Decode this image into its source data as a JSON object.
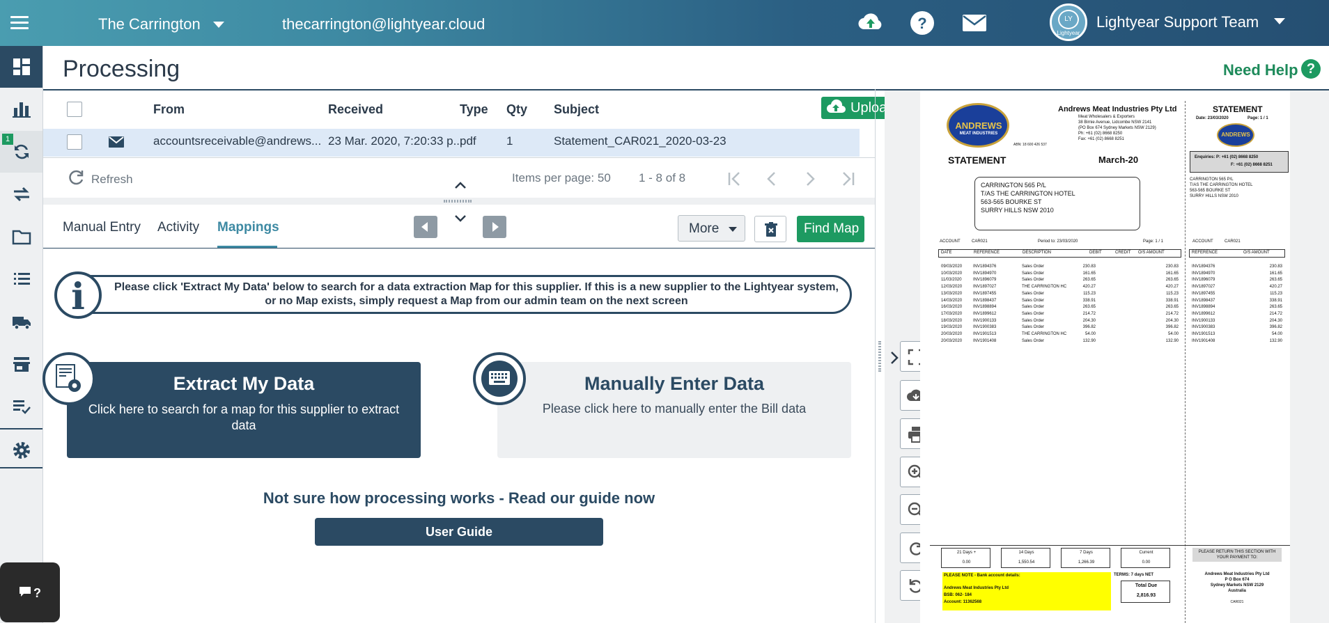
{
  "topbar": {
    "org_name": "The Carrington",
    "email": "thecarrington@lightyear.cloud",
    "user_name": "Lightyear Support Team",
    "avatar_text": "Lightyear",
    "avatar_mono": "LY"
  },
  "sidebar": {
    "badge": "1"
  },
  "header": {
    "title": "Processing",
    "need_help": "Need Help",
    "help_glyph": "?"
  },
  "table": {
    "columns": [
      "From",
      "Received",
      "Type",
      "Qty",
      "Subject"
    ],
    "upload_label": "Upload",
    "rows": [
      {
        "from": "accountsreceivable@andrews...",
        "received": "23 Mar. 2020, 7:20:33 p...",
        "type": "pdf",
        "qty": "1",
        "subject": "Statement_CAR021_2020-03-23"
      }
    ]
  },
  "paginator": {
    "refresh": "Refresh",
    "items_per_page_label": "Items per page:",
    "items_per_page": "50",
    "range": "1 - 8 of 8"
  },
  "tabs": {
    "items": [
      "Manual Entry",
      "Activity",
      "Mappings"
    ],
    "active": "Mappings",
    "more_label": "More",
    "find_map_label": "Find Map"
  },
  "info": {
    "glyph": "i",
    "text": "Please click 'Extract My Data' below to search for a data extraction Map for this supplier. If this is a new supplier to the Lightyear system, or no Map exists, simply request a Map from our admin team on the next screen"
  },
  "cards": {
    "extract_title": "Extract My Data",
    "extract_desc": "Click here to search for a map for this supplier to extract data",
    "manual_title": "Manually Enter Data",
    "manual_desc": "Please click here to manually enter the Bill data"
  },
  "guide": {
    "text": "Not sure how processing works - Read our guide now",
    "button": "User Guide"
  },
  "chat": {
    "label": "…?"
  },
  "document": {
    "company": "Andrews Meat Industries Pty Ltd",
    "addr1": "Meat Wholesalers & Exporters",
    "addr2": "38 Birnie Avenue, Lidcombe NSW 2141",
    "addr3": "(PO Box 674 Sydney Markets NSW 2129)",
    "addr4": "Ph:  +61 (02) 8668 8250",
    "addr5": "Fax: +61 (02) 8668 8251",
    "abn": "ABN: 18 600 426 537",
    "logo_text": "ANDREWS",
    "logo_sub": "MEAT INDUSTRIES",
    "statement": "STATEMENT",
    "period": "March-20",
    "date_line": "Date: 23/03/2020",
    "page_line": "Page: 1 / 1",
    "enquiries_p": "Enquiries:  P: +61 (02) 8668 8250",
    "enquiries_f": "F: +61 (02) 8668 8251",
    "customer": [
      "CARRINGTON 565 P/L",
      "T/AS THE CARRINGTON HOTEL",
      "563-565 BOURKE ST",
      "SURRY HILLS     NSW     2010"
    ],
    "customer_small": [
      "CARRINGTON 565 P/L",
      "T/AS THE CARRINGTON HOTEL",
      "563-565 BOURKE ST",
      "SURRY HILLS     NSW     2010"
    ],
    "account_label": "ACCOUNT",
    "account": "CAR021",
    "period_to": "Period to:   23/03/2020",
    "page_small": "Page:  1 / 1",
    "cols": [
      "DATE",
      "REFERENCE",
      "DESCRIPTION",
      "DEBIT",
      "CREDIT",
      "O/S AMOUNT"
    ],
    "cols_small": [
      "REFERENCE",
      "O/S AMOUNT"
    ],
    "lines": [
      [
        "09/03/2020",
        "INV1894376",
        "Sales Order",
        "230.83",
        "230.83"
      ],
      [
        "10/03/2020",
        "INV1894970",
        "Sales Order",
        "161.65",
        "161.65"
      ],
      [
        "11/03/2020",
        "INV1896079",
        "Sales Order",
        "263.65",
        "263.65"
      ],
      [
        "12/03/2020",
        "INV1897027",
        "THE CARRINGTON HC",
        "420.27",
        "420.27"
      ],
      [
        "13/03/2020",
        "INV1897455",
        "Sales Order",
        "115.23",
        "115.23"
      ],
      [
        "14/03/2020",
        "INV1898437",
        "Sales Order",
        "338.91",
        "338.91"
      ],
      [
        "16/03/2020",
        "INV1898894",
        "Sales Order",
        "263.65",
        "263.65"
      ],
      [
        "17/03/2020",
        "INV1899612",
        "Sales Order",
        "214.72",
        "214.72"
      ],
      [
        "18/03/2020",
        "INV1900133",
        "Sales Order",
        "204.30",
        "204.30"
      ],
      [
        "19/03/2020",
        "INV1900383",
        "Sales Order",
        "396.82",
        "396.82"
      ],
      [
        "20/03/2020",
        "INV1901513",
        "THE CARRINGTON HC",
        "54.00",
        "54.00"
      ],
      [
        "20/03/2020",
        "INV1901408",
        "Sales Order",
        "132.90",
        "132.90"
      ]
    ],
    "aging": [
      {
        "label": "21 Days +",
        "value": "0.00"
      },
      {
        "label": "14 Days",
        "value": "1,550.54"
      },
      {
        "label": "7 Days",
        "value": "1,266.39"
      },
      {
        "label": "Current",
        "value": "0.00"
      }
    ],
    "bank": [
      "PLEASE NOTE - Bank account details:",
      "",
      "Andrews Meat Industries Pty Ltd",
      "BSB:      062- 184",
      "Account:              11362568"
    ],
    "terms": "TERMS:     7 days NET",
    "total_due_label": "Total Due",
    "total_due": "2,816.93",
    "return_note": "PLEASE RETURN THIS SECTION WITH YOUR PAYMENT TO:",
    "remit": [
      "Andrews Meat Industries Pty Ltd",
      "P O Box 674",
      "Sydney Markets NSW 2129",
      "Australia",
      "CAR021"
    ]
  }
}
